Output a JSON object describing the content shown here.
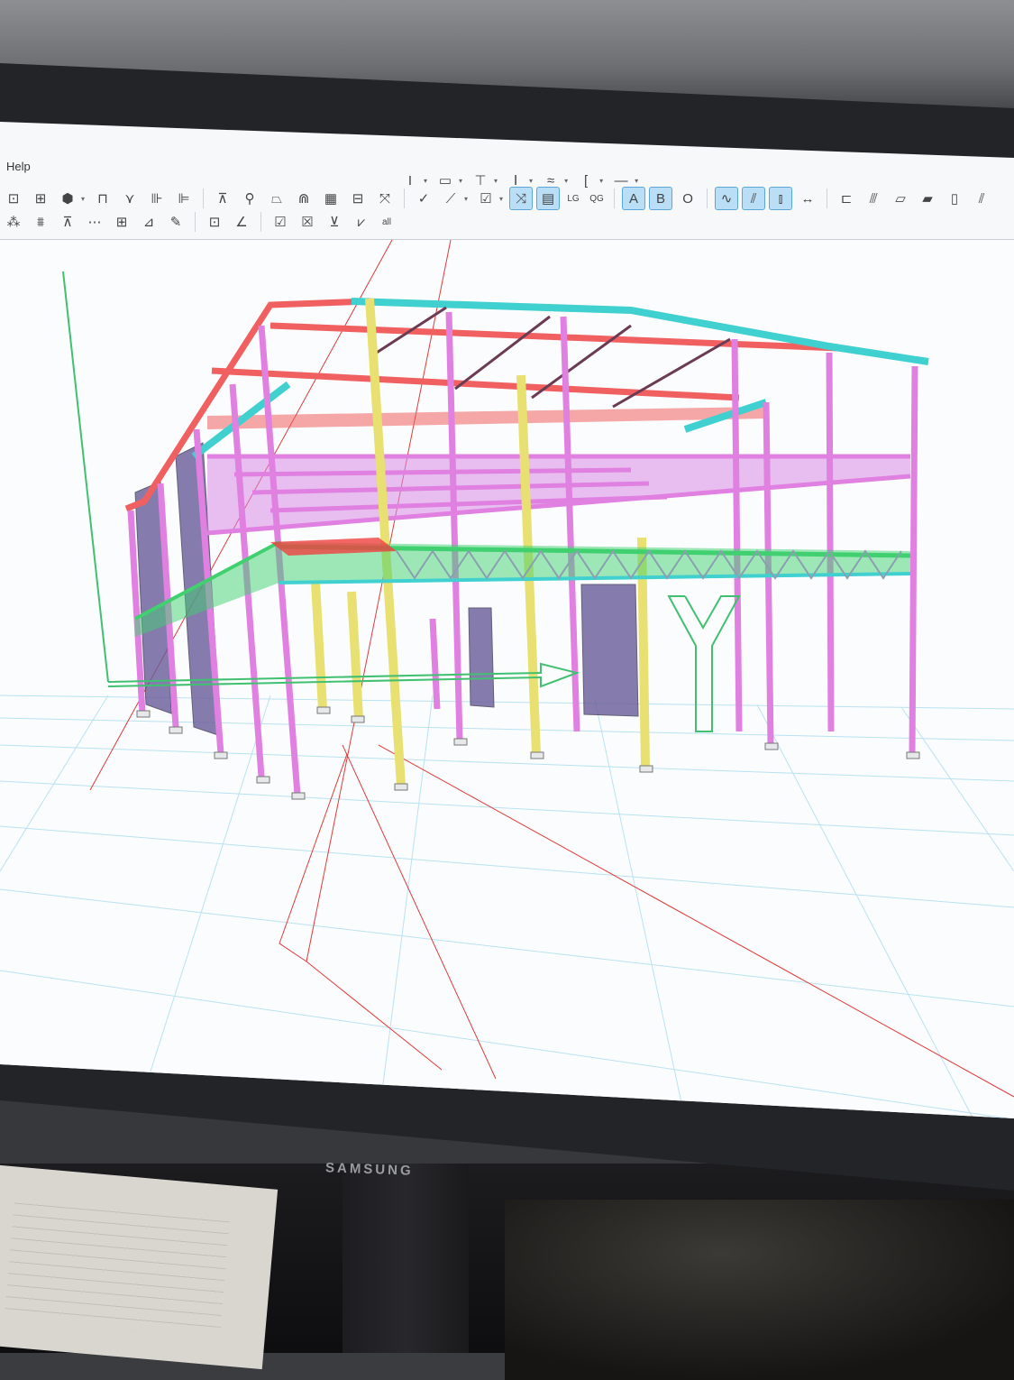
{
  "menu": {
    "help_label": "Help"
  },
  "toolbar": {
    "text_buttons": {
      "lg": "LG",
      "qg": "QG",
      "all": "all",
      "a": "A",
      "b": "B",
      "o": "O"
    }
  },
  "monitor": {
    "brand": "SAMSUNG"
  },
  "model_view": {
    "axis_label": "Y",
    "member_colors": {
      "rafters": "#f06060",
      "columns": "#e080e0",
      "primary_columns": "#e8e070",
      "mezzanine_trusses": "#40d070",
      "ridge_purlins": "#40d0d0",
      "wall_panels": "#6a5c9a",
      "ground_grid": "#9ed8ec",
      "guides": "#e03a3a"
    }
  },
  "icons": [
    "beam-i-icon",
    "column-icon",
    "rectangle-icon",
    "check-icon",
    "frame-icon",
    "truss-icon",
    "plate-icon",
    "channel-icon",
    "zoom-fit-icon"
  ]
}
